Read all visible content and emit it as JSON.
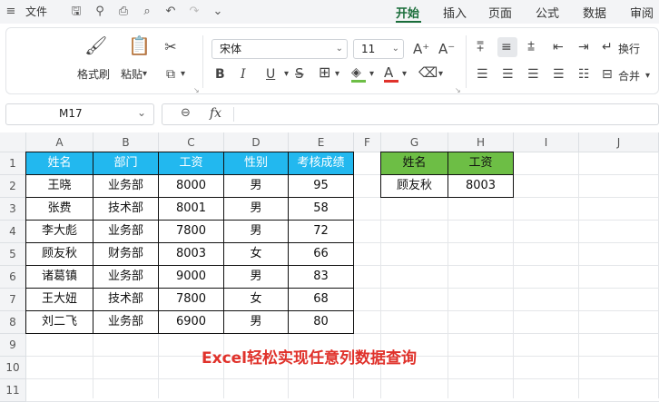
{
  "menu": {
    "file_label": "文件",
    "tabs": [
      {
        "label": "开始",
        "active": true
      },
      {
        "label": "插入",
        "active": false
      },
      {
        "label": "页面",
        "active": false
      },
      {
        "label": "公式",
        "active": false
      },
      {
        "label": "数据",
        "active": false
      },
      {
        "label": "审阅",
        "active": false
      }
    ],
    "accent_color": "#1a6d3a"
  },
  "ribbon": {
    "format_painter_label": "格式刷",
    "paste_label": "粘贴",
    "font_name": "宋体",
    "font_size": "11",
    "wrap_label": "换行",
    "merge_label": "合并"
  },
  "formula_bar": {
    "name_box": "M17",
    "fx_label": "fx",
    "formula": ""
  },
  "sheet": {
    "columns": [
      "A",
      "B",
      "C",
      "D",
      "E",
      "F",
      "G",
      "H",
      "I",
      "J"
    ],
    "rows": [
      "1",
      "2",
      "3",
      "4",
      "5",
      "6",
      "7",
      "8",
      "9",
      "10",
      "11"
    ],
    "main_table": {
      "headers": [
        "姓名",
        "部门",
        "工资",
        "性别",
        "考核成绩"
      ],
      "header_color": "#22b8ef",
      "data": [
        [
          "王晓",
          "业务部",
          "8000",
          "男",
          "95"
        ],
        [
          "张费",
          "技术部",
          "8001",
          "男",
          "58"
        ],
        [
          "李大彪",
          "业务部",
          "7800",
          "男",
          "72"
        ],
        [
          "顾友秋",
          "财务部",
          "8003",
          "女",
          "66"
        ],
        [
          "诸葛镇",
          "业务部",
          "9000",
          "男",
          "83"
        ],
        [
          "王大妞",
          "技术部",
          "7800",
          "女",
          "68"
        ],
        [
          "刘二飞",
          "业务部",
          "6900",
          "男",
          "80"
        ]
      ]
    },
    "lookup_table": {
      "headers": [
        "姓名",
        "工资"
      ],
      "header_color": "#6dbe45",
      "data": [
        [
          "顾友秋",
          "8003"
        ]
      ]
    },
    "caption": "Excel轻松实现任意列数据查询",
    "caption_color": "#e0322b"
  }
}
